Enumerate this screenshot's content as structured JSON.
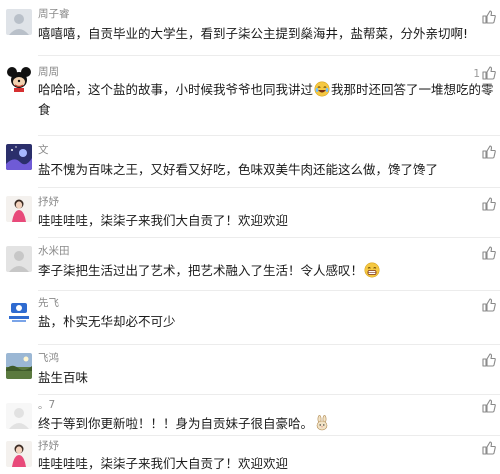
{
  "comments": [
    {
      "name": "周子睿",
      "text": "嘻嘻嘻，自贡毕业的大学生，看到子柒公主提到燊海井，盐帮菜，分外亲切啊!",
      "likes": ""
    },
    {
      "name": "周周",
      "text_a": "哈哈哈，这个盐的故事，小时候我爷爷也同我讲过",
      "text_b": "我那时还回答了一堆想吃的零",
      "text_c": "食",
      "likes": "1"
    },
    {
      "name": "文",
      "text": "盐不愧为百味之王，又好看又好吃，色味双美牛肉还能这么做，馋了馋了",
      "likes": ""
    },
    {
      "name": "抒妤",
      "text": "哇哇哇哇，柒柒子来我们大自贡了！欢迎欢迎",
      "likes": ""
    },
    {
      "name": "水米田",
      "text": "李子柒把生活过出了艺术，把艺术融入了生活！令人感叹！",
      "likes": ""
    },
    {
      "name": "先飞",
      "text": "盐，朴实无华却必不可少",
      "likes": ""
    },
    {
      "name": "飞鸿",
      "text": "盐生百味",
      "likes": ""
    },
    {
      "name": "。7",
      "text": "终于等到你更新啦！！！身为自贡妹子很自豪哈。",
      "likes": ""
    },
    {
      "name": "抒妤",
      "text": "哇哇哇哇，柒柒子来我们大自贡了！欢迎欢迎",
      "likes": ""
    }
  ],
  "icons": {
    "like": "thumbs-up-icon",
    "emoji_grin": "grinning-face-emoji",
    "emoji_laugh": "laughing-face-emoji",
    "emoji_rabbit": "rabbit-emoji"
  },
  "colors": {
    "name": "#8a8a8a",
    "text": "#1a1a1a",
    "like": "#8a8a8a",
    "divider": "#ececec"
  }
}
